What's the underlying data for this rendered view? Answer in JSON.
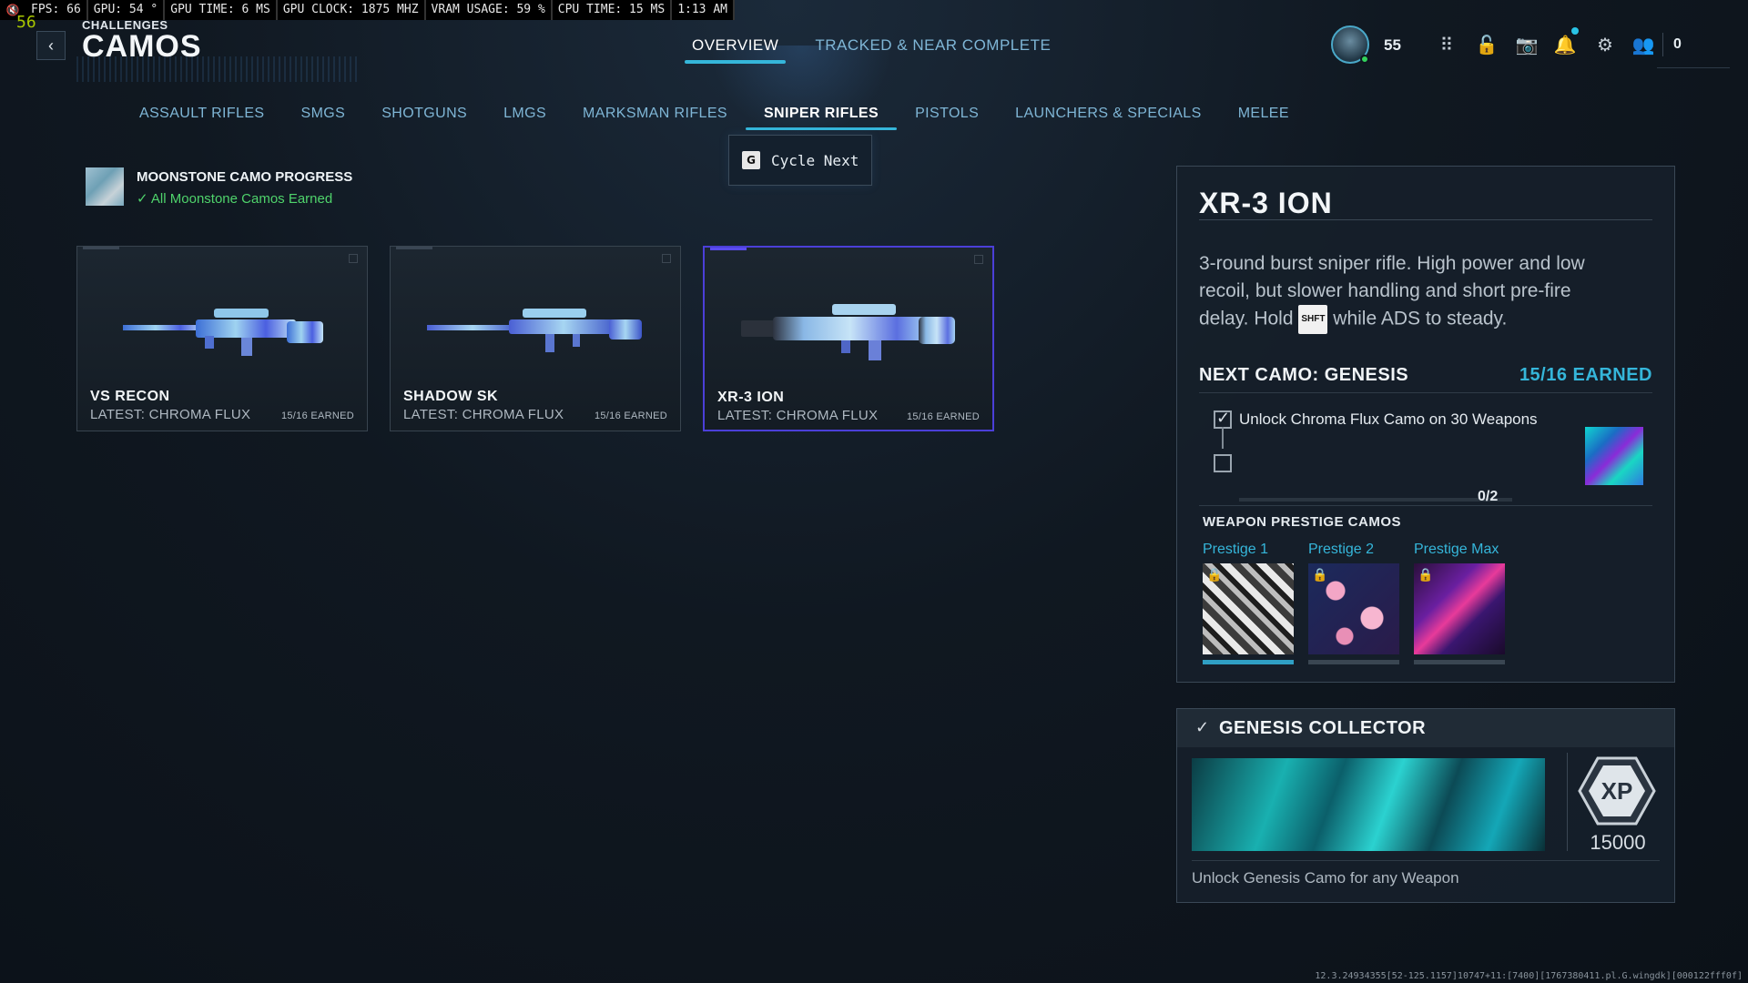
{
  "perf": {
    "mute_icon": "speaker-mute-icon",
    "segments": [
      "FPS:  66",
      "GPU: 54 °",
      "GPU TIME:  6 MS",
      "GPU CLOCK: 1875 MHZ",
      "VRAM USAGE: 59 %",
      "CPU TIME: 15 MS",
      "1:13 AM"
    ],
    "fps_overlay": "56"
  },
  "header": {
    "section": "CHALLENGES",
    "title": "CAMOS",
    "tabs": [
      "OVERVIEW",
      "TRACKED & NEAR COMPLETE"
    ],
    "active_tab": 0
  },
  "profile": {
    "level": "55",
    "currency": "0"
  },
  "categories": {
    "items": [
      "ASSAULT RIFLES",
      "SMGS",
      "SHOTGUNS",
      "LMGS",
      "MARKSMAN RIFLES",
      "SNIPER RIFLES",
      "PISTOLS",
      "LAUNCHERS & SPECIALS",
      "MELEE"
    ],
    "active": 5
  },
  "cycle": {
    "key": "G",
    "label": "Cycle Next"
  },
  "moonstone": {
    "title": "MOONSTONE CAMO PROGRESS",
    "status": "All Moonstone Camos Earned"
  },
  "weapons": [
    {
      "name": "VS RECON",
      "latest": "LATEST: CHROMA FLUX",
      "earned": "15/16 EARNED"
    },
    {
      "name": "SHADOW SK",
      "latest": "LATEST: CHROMA FLUX",
      "earned": "15/16 EARNED"
    },
    {
      "name": "XR-3 ION",
      "latest": "LATEST: CHROMA FLUX",
      "earned": "15/16 EARNED"
    }
  ],
  "detail": {
    "title": "XR-3 ION",
    "desc_part1": "3-round burst sniper rifle. High power and low recoil, but slower handling and short pre-fire delay. Hold ",
    "desc_key": "SHFT",
    "desc_part2": " while ADS to steady.",
    "next_camo": "NEXT CAMO: GENESIS",
    "next_earned": "15/16 EARNED",
    "challenge": "Unlock Chroma Flux Camo on 30 Weapons",
    "progress": "0/2",
    "prestige_header": "WEAPON PRESTIGE CAMOS",
    "prestige": [
      {
        "name": "Prestige 1"
      },
      {
        "name": "Prestige 2"
      },
      {
        "name": "Prestige Max"
      }
    ]
  },
  "genesis": {
    "title": "GENESIS COLLECTOR",
    "xp_label": "XP",
    "xp": "15000",
    "desc": "Unlock Genesis Camo for any Weapon"
  },
  "build": "12.3.24934355[52-125.1157]10747+11:[7400][1767380411.pl.G.wingdk][000122fff0f]"
}
